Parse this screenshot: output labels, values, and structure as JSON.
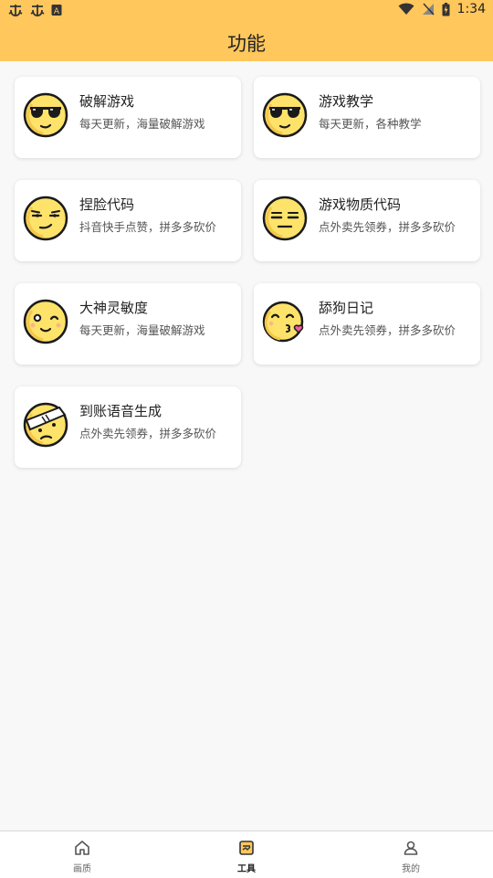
{
  "status_bar": {
    "time": "1:34"
  },
  "header": {
    "title": "功能"
  },
  "cards": [
    {
      "title": "破解游戏",
      "subtitle": "每天更新，海量破解游戏",
      "icon": "sunglasses-face-icon"
    },
    {
      "title": "游戏教学",
      "subtitle": "每天更新，各种教学",
      "icon": "sunglasses-face-icon"
    },
    {
      "title": "捏脸代码",
      "subtitle": "抖音快手点赞，拼多多砍价",
      "icon": "smirk-face-icon"
    },
    {
      "title": "游戏物质代码",
      "subtitle": "点外卖先领券，拼多多砍价",
      "icon": "expressionless-face-icon"
    },
    {
      "title": "大神灵敏度",
      "subtitle": "每天更新，海量破解游戏",
      "icon": "wink-face-icon"
    },
    {
      "title": "舔狗日记",
      "subtitle": "点外卖先领券，拼多多砍价",
      "icon": "kissing-heart-face-icon"
    },
    {
      "title": "到账语音生成",
      "subtitle": "点外卖先领券，拼多多砍价",
      "icon": "bandaged-face-icon"
    }
  ],
  "tabbar": {
    "tabs": [
      {
        "label": "画质",
        "icon": "home-icon",
        "active": false
      },
      {
        "label": "工具",
        "icon": "tools-icon",
        "active": true
      },
      {
        "label": "我的",
        "icon": "user-icon",
        "active": false
      }
    ]
  },
  "colors": {
    "accent": "#ffc75c",
    "face": "#fde36a",
    "outline": "#1a1a1a"
  }
}
